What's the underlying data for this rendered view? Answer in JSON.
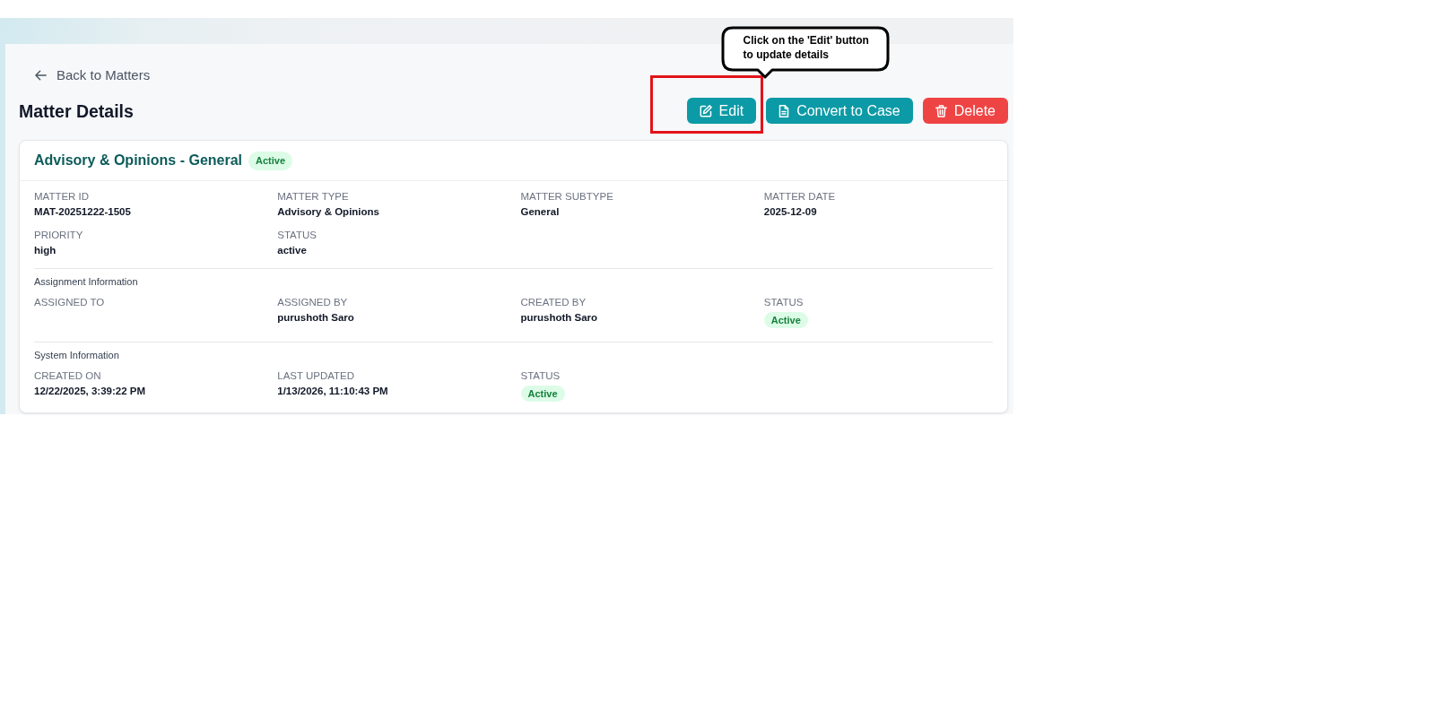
{
  "back_link": {
    "label": "Back to Matters"
  },
  "page_title": "Matter Details",
  "actions": [
    {
      "kind": "edit",
      "label": "Edit",
      "highlighted": true
    },
    {
      "kind": "convert",
      "label": "Convert to Case",
      "highlighted": false
    },
    {
      "kind": "delete",
      "label": "Delete",
      "highlighted": false
    }
  ],
  "annotation": {
    "text": "Click on the 'Edit' button to update details"
  },
  "matter": {
    "title": "Advisory & Opinions - General",
    "badge": "Active",
    "fields": [
      {
        "kind": "text",
        "label": "MATTER ID",
        "value": "MAT-20251222-1505"
      },
      {
        "kind": "text",
        "label": "MATTER TYPE",
        "value": "Advisory & Opinions"
      },
      {
        "kind": "text",
        "label": "MATTER SUBTYPE",
        "value": "General"
      },
      {
        "kind": "text",
        "label": "MATTER DATE",
        "value": "2025-12-09"
      },
      {
        "kind": "text",
        "label": "PRIORITY",
        "value": "high"
      },
      {
        "kind": "text",
        "label": "STATUS",
        "value": "active"
      }
    ]
  },
  "sections": [
    {
      "heading": "Assignment Information",
      "fields": [
        {
          "kind": "text",
          "label": "ASSIGNED TO"
        },
        {
          "kind": "text",
          "label": "ASSIGNED BY",
          "value": "purushoth Saro"
        },
        {
          "kind": "text",
          "label": "CREATED BY",
          "value": "purushoth Saro"
        },
        {
          "kind": "badge",
          "label": "STATUS",
          "value": "Active"
        }
      ]
    },
    {
      "heading": "System Information",
      "fields": [
        {
          "kind": "text",
          "label": "CREATED ON",
          "value": "12/22/2025, 3:39:22 PM"
        },
        {
          "kind": "text",
          "label": "LAST UPDATED",
          "value": "1/13/2026, 11:10:43 PM"
        },
        {
          "kind": "badge",
          "label": "STATUS",
          "value": "Active"
        }
      ]
    }
  ]
}
